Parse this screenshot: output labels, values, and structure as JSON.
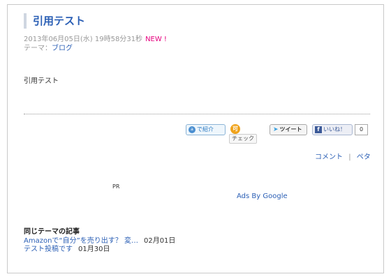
{
  "article": {
    "title": "引用テスト",
    "date": "2013年06月05日(水) 19時58分31秒",
    "new_badge": "NEW !",
    "theme_label": "テーマ：",
    "theme_value": "ブログ",
    "body": "引用テスト"
  },
  "share": {
    "shoukai_label": "で紹介",
    "shoukai_icon": "ameba-icon",
    "check_label": "チェック",
    "check_icon_text": "可",
    "tweet_label": "ツイート",
    "like_label": "いいね！",
    "like_count": "0"
  },
  "actions": {
    "comment": "コメント",
    "separator": "|",
    "peta": "ペタ"
  },
  "ads": {
    "pr_label": "PR",
    "ads_by_google": "Ads By Google"
  },
  "related": {
    "heading": "同じテーマの記事",
    "items": [
      {
        "title": "Amazonで“自分”を売り出す？ 変…",
        "date": "02月01日"
      },
      {
        "title": "テスト投稿です",
        "date": "01月30日"
      }
    ]
  },
  "colors": {
    "link": "#2b5fb5",
    "new_badge": "#e6007e",
    "title_accent": "#cfd6e1"
  }
}
